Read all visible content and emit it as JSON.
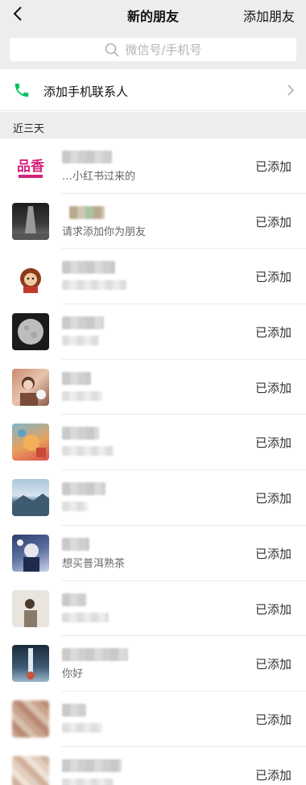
{
  "header": {
    "title": "新的朋友",
    "add_friend": "添加朋友"
  },
  "search": {
    "placeholder": "微信号/手机号"
  },
  "contacts_entry": {
    "label": "添加手机联系人"
  },
  "section": {
    "title": "近三天"
  },
  "requests": [
    {
      "message": "…小红书过来的",
      "status": "已添加"
    },
    {
      "message": "请求添加你为朋友",
      "status": "已添加"
    },
    {
      "message": "",
      "status": "已添加"
    },
    {
      "message": "",
      "status": "已添加"
    },
    {
      "message": "",
      "status": "已添加"
    },
    {
      "message": "",
      "status": "已添加"
    },
    {
      "message": "",
      "status": "已添加"
    },
    {
      "message": "想买普洱熟茶",
      "status": "已添加"
    },
    {
      "message": "",
      "status": "已添加"
    },
    {
      "message": "你好",
      "status": "已添加"
    },
    {
      "message": "",
      "status": "已添加"
    },
    {
      "message": "",
      "status": "已添加"
    }
  ],
  "colors": {
    "accent_green": "#07c160",
    "nav_bg": "#ededed"
  }
}
